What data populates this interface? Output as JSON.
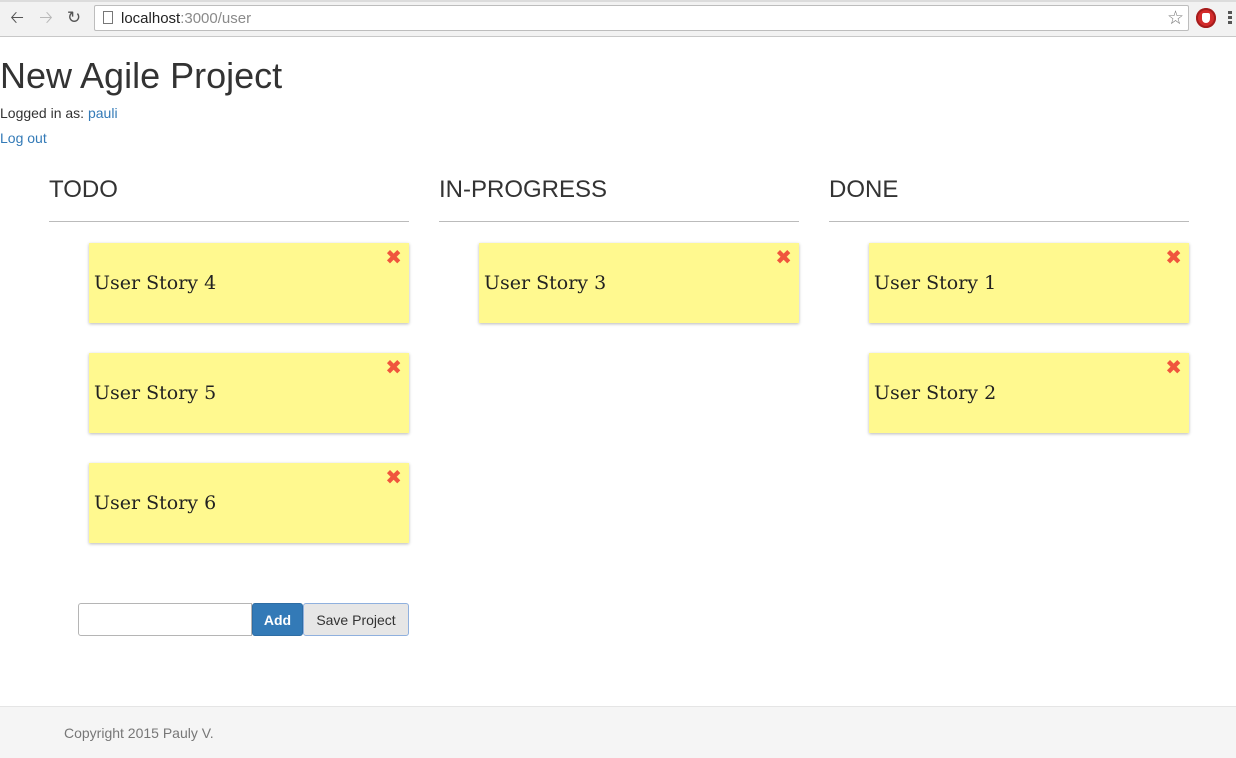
{
  "browser": {
    "url_host": "localhost",
    "url_path": ":3000/user",
    "icons": [
      "back-arrow-icon",
      "forward-arrow-icon",
      "reload-icon",
      "page-icon",
      "star-icon",
      "adblock-icon",
      "menu-icon"
    ]
  },
  "header": {
    "title": "New Agile Project",
    "logged_in_label": "Logged in as: ",
    "username": "pauli",
    "logout_label": "Log out"
  },
  "board": {
    "columns": [
      {
        "title": "TODO",
        "cards": [
          "User Story 4",
          "User Story 5",
          "User Story 6"
        ]
      },
      {
        "title": "IN-PROGRESS",
        "cards": [
          "User Story 3"
        ]
      },
      {
        "title": "DONE",
        "cards": [
          "User Story 1",
          "User Story 2"
        ]
      }
    ],
    "card_color": "#fff98f",
    "close_color": "#f0553d"
  },
  "form": {
    "input_value": "",
    "add_label": "Add",
    "save_label": "Save Project"
  },
  "footer": {
    "text": "Copyright 2015 Pauly V."
  }
}
